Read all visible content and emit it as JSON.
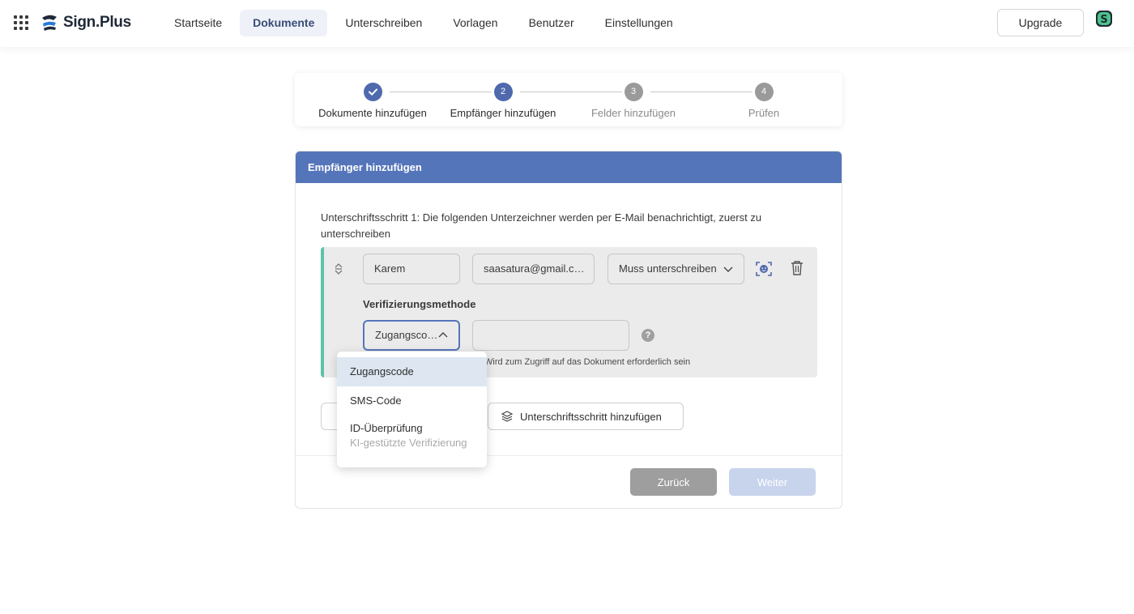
{
  "header": {
    "logo_text": "Sign.Plus",
    "nav": [
      "Startseite",
      "Dokumente",
      "Unterschreiben",
      "Vorlagen",
      "Benutzer",
      "Einstellungen"
    ],
    "active_nav": "Dokumente",
    "upgrade_label": "Upgrade"
  },
  "stepper": {
    "steps": [
      {
        "number": "",
        "label": "Dokumente hinzufügen",
        "state": "done"
      },
      {
        "number": "2",
        "label": "Empfänger hinzufügen",
        "state": "current"
      },
      {
        "number": "3",
        "label": "Felder hinzufügen",
        "state": "pending"
      },
      {
        "number": "4",
        "label": "Prüfen",
        "state": "pending"
      }
    ]
  },
  "card": {
    "title": "Empfänger hinzufügen",
    "step_description": "Unterschriftsschritt 1: Die folgenden Unterzeichner werden per E-Mail benachrichtigt, zuerst zu unterschreiben",
    "signer": {
      "name": "Karem",
      "email": "saasatura@gmail.c…",
      "role": "Muss unterschreiben",
      "verification_label": "Verifizierungsmethode",
      "verification_value": "Zugangsco…",
      "code_value": "",
      "hint": "Wird zum Zugriff auf das Dokument erforderlich sein"
    },
    "add_step_label": "Unterschriftsschritt hinzufügen",
    "back_label": "Zurück",
    "next_label": "Weiter"
  },
  "dropdown": {
    "options": [
      {
        "label": "Zugangscode",
        "sub": "",
        "selected": true
      },
      {
        "label": "SMS-Code",
        "sub": "",
        "selected": false
      },
      {
        "label": "ID-Überprüfung",
        "sub": "KI-gestützte Verifizierung",
        "selected": false
      }
    ]
  },
  "colors": {
    "brand": "#5575ba",
    "accent_border": "#5cc3a8",
    "button_back": "#9e9e9e",
    "button_next_disabled": "#c8d4ec"
  }
}
